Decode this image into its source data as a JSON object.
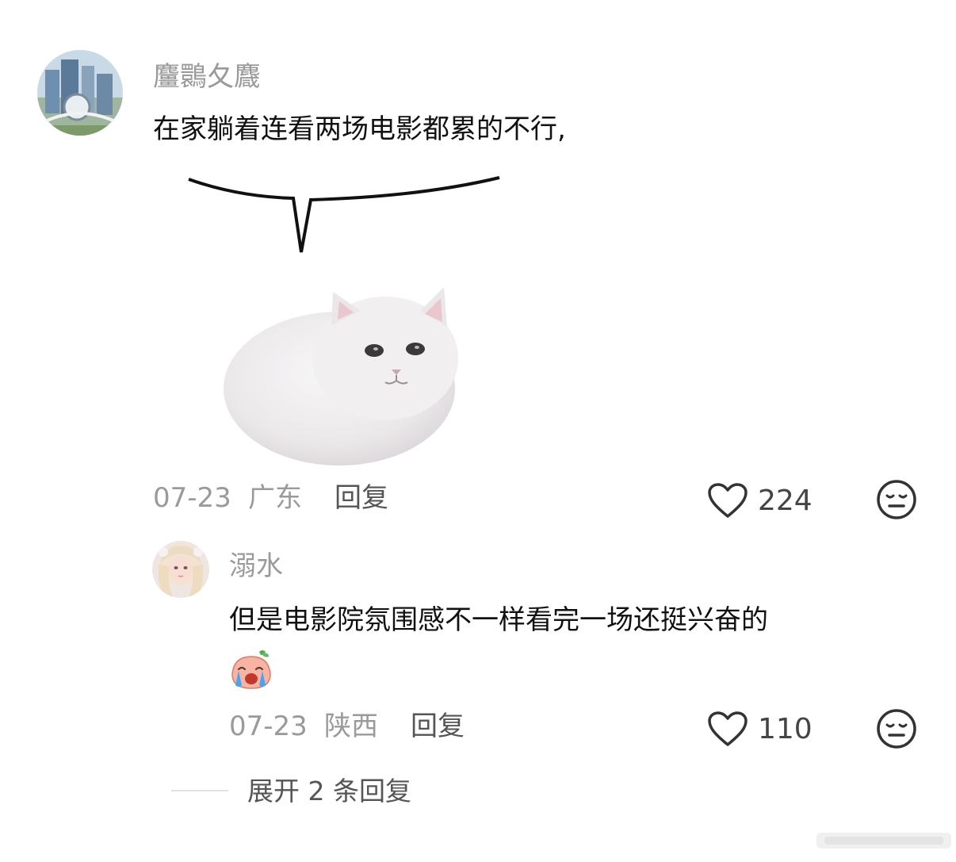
{
  "comment": {
    "username": "麠䴉夂麙",
    "text": "在家躺着连看两场电影都累的不行,",
    "image_icon": "white-cat-speech-bubble-sticker",
    "date": "07-23",
    "location": "广东",
    "reply_label": "回复",
    "like_count": "224",
    "like_icon": "heart-icon",
    "dislike_icon": "meh-face-icon"
  },
  "reply": {
    "username": "溺水",
    "text": "但是电影院氛围感不一样看完一场还挺兴奋的",
    "emoji_icon": "crying-peach-emoji",
    "date": "07-23",
    "location": "陕西",
    "reply_label": "回复",
    "like_count": "110",
    "like_icon": "heart-icon",
    "dislike_icon": "meh-face-icon"
  },
  "expand_replies_label": "展开 2 条回复"
}
